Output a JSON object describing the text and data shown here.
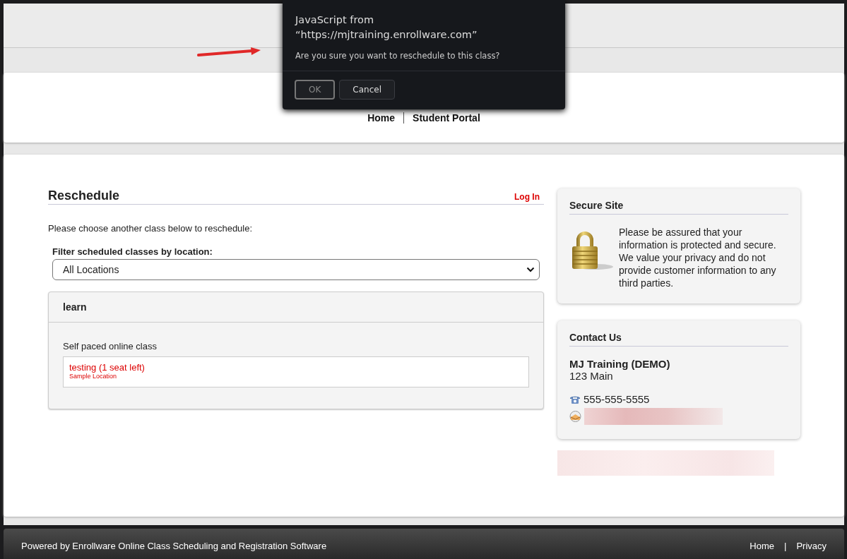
{
  "dialog": {
    "title_lines": [
      "JavaScript from",
      "“https://mjtraining.enrollware.com”"
    ],
    "message": "Are you sure you want to reschedule to this class?",
    "buttons": [
      {
        "label": "OK",
        "selected": true
      },
      {
        "label": "Cancel",
        "selected": false
      }
    ]
  },
  "nav": [
    {
      "label": "Home"
    },
    {
      "label": "Student Portal"
    }
  ],
  "reschedule": {
    "title": "Reschedule",
    "login": "Log In",
    "intro": "Please choose another class below to reschedule:",
    "filter_label": "Filter scheduled classes by location:",
    "filter_value": "All Locations",
    "group": {
      "title": "learn",
      "subtitle": "Self paced online class",
      "classes": [
        {
          "name": "testing (1 seat left)",
          "location": "Sample Location"
        }
      ]
    }
  },
  "secure": {
    "title": "Secure Site",
    "text": "Please be assured that your information is protected and secure. We value your privacy and do not provide customer information to any third parties."
  },
  "contact": {
    "title": "Contact Us",
    "company": "MJ Training (DEMO)",
    "address": "123 Main",
    "phone": "555-555-5555"
  },
  "footer": {
    "text": "Powered by Enrollware Online Class Scheduling and Registration Software",
    "links": [
      "Home",
      "Privacy"
    ],
    "separator": "|"
  }
}
